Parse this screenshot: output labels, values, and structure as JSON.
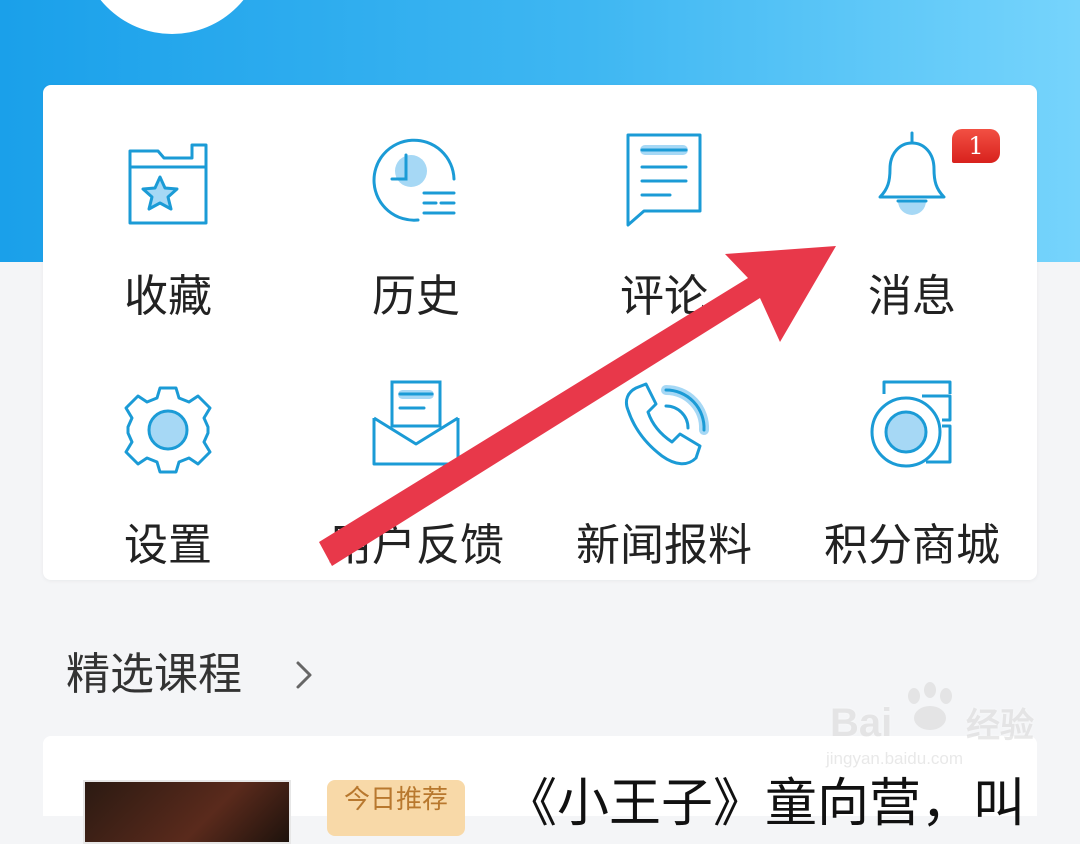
{
  "colors": {
    "accent": "#1aa0ea",
    "icon_stroke": "#1b9bd6",
    "icon_fill": "#a6d8f5",
    "badge": "#e02b22",
    "annotation_arrow": "#e8384a"
  },
  "menu": {
    "row1": [
      {
        "label": "收藏",
        "icon": "favorites-folder-star-icon"
      },
      {
        "label": "历史",
        "icon": "history-clock-icon"
      },
      {
        "label": "评论",
        "icon": "comment-document-icon"
      },
      {
        "label": "消息",
        "icon": "bell-icon",
        "badge": "1"
      }
    ],
    "row2": [
      {
        "label": "设置",
        "icon": "settings-gear-icon"
      },
      {
        "label": "用户反馈",
        "icon": "feedback-envelope-icon"
      },
      {
        "label": "新闻报料",
        "icon": "news-tip-phone-icon"
      },
      {
        "label": "积分商城",
        "icon": "points-mall-coin-icon"
      }
    ]
  },
  "section": {
    "title": "精选课程",
    "more_icon": "chevron-right-icon"
  },
  "course": {
    "tag": "今日推荐",
    "title": "《小王子》童向营，叫"
  },
  "watermark": {
    "brand": "Bai",
    "sub": "经验",
    "url": "jingyan.baidu.com"
  }
}
